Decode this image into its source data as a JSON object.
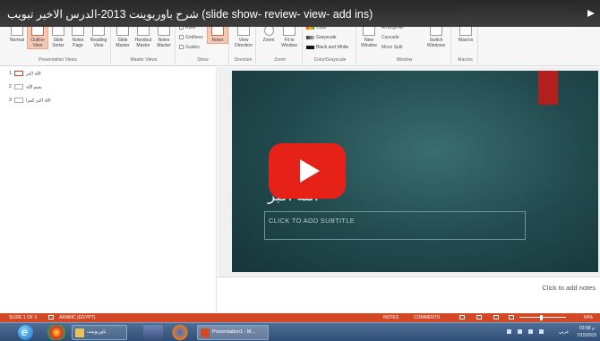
{
  "video": {
    "title": "شرح باوربوينت 2013-الدرس الاخير تبويب (slide show- review- view- add ins)"
  },
  "ribbon": {
    "presentation_views": {
      "label": "Presentation Views",
      "normal": "Normal",
      "outline_view": "Outline View",
      "slide_sorter": "Slide Sorter",
      "notes_page": "Notes Page",
      "reading_view": "Reading View"
    },
    "master_views": {
      "label": "Master Views",
      "slide_master": "Slide Master",
      "handout_master": "Handout Master",
      "notes_master": "Notes Master"
    },
    "show": {
      "label": "Show",
      "ruler": "Ruler",
      "gridlines": "Gridlines",
      "guides": "Guides",
      "notes": "Notes"
    },
    "direction": {
      "label": "Direction",
      "view_direction": "View Direction"
    },
    "zoom": {
      "label": "Zoom",
      "zoom": "Zoom",
      "fit_to_window": "Fit to Window"
    },
    "color_grayscale": {
      "label": "Color/Grayscale",
      "color": "Color",
      "grayscale": "Grayscale",
      "black_and_white": "Black and White"
    },
    "window": {
      "label": "Window",
      "new_window": "New Window",
      "arrange_all": "Arrange All",
      "cascade": "Cascade",
      "move_split": "Move Split",
      "switch_windows": "Switch Windows"
    },
    "macros": {
      "label": "Macros",
      "macros": "Macros"
    }
  },
  "outline": [
    {
      "num": "1",
      "text": "الله اكبر"
    },
    {
      "num": "2",
      "text": "بسم الله"
    },
    {
      "num": "3",
      "text": "الله اكبر كبيرا"
    }
  ],
  "slide": {
    "title": "الله اكبر",
    "subtitle_placeholder": "CLICK TO ADD SUBTITLE"
  },
  "notes": {
    "hint": "Click to add notes"
  },
  "status_bar": {
    "slide_info": "SLIDE 1 OF 3",
    "language": "ARABIC (EGYPT)",
    "notes_btn": "NOTES",
    "comments_btn": "COMMENTS",
    "zoom": "64%"
  },
  "taskbar": {
    "folder_task": "باوربوينت",
    "ppt_task": "Presentation1 - M...",
    "time": "03:58 م",
    "date": "7/15/2015",
    "lang": "عربي"
  },
  "colors": {
    "accent": "#d24726",
    "play_button": "#e62117",
    "slide_bg": "#21494d",
    "slide_accent": "#b3201c"
  }
}
